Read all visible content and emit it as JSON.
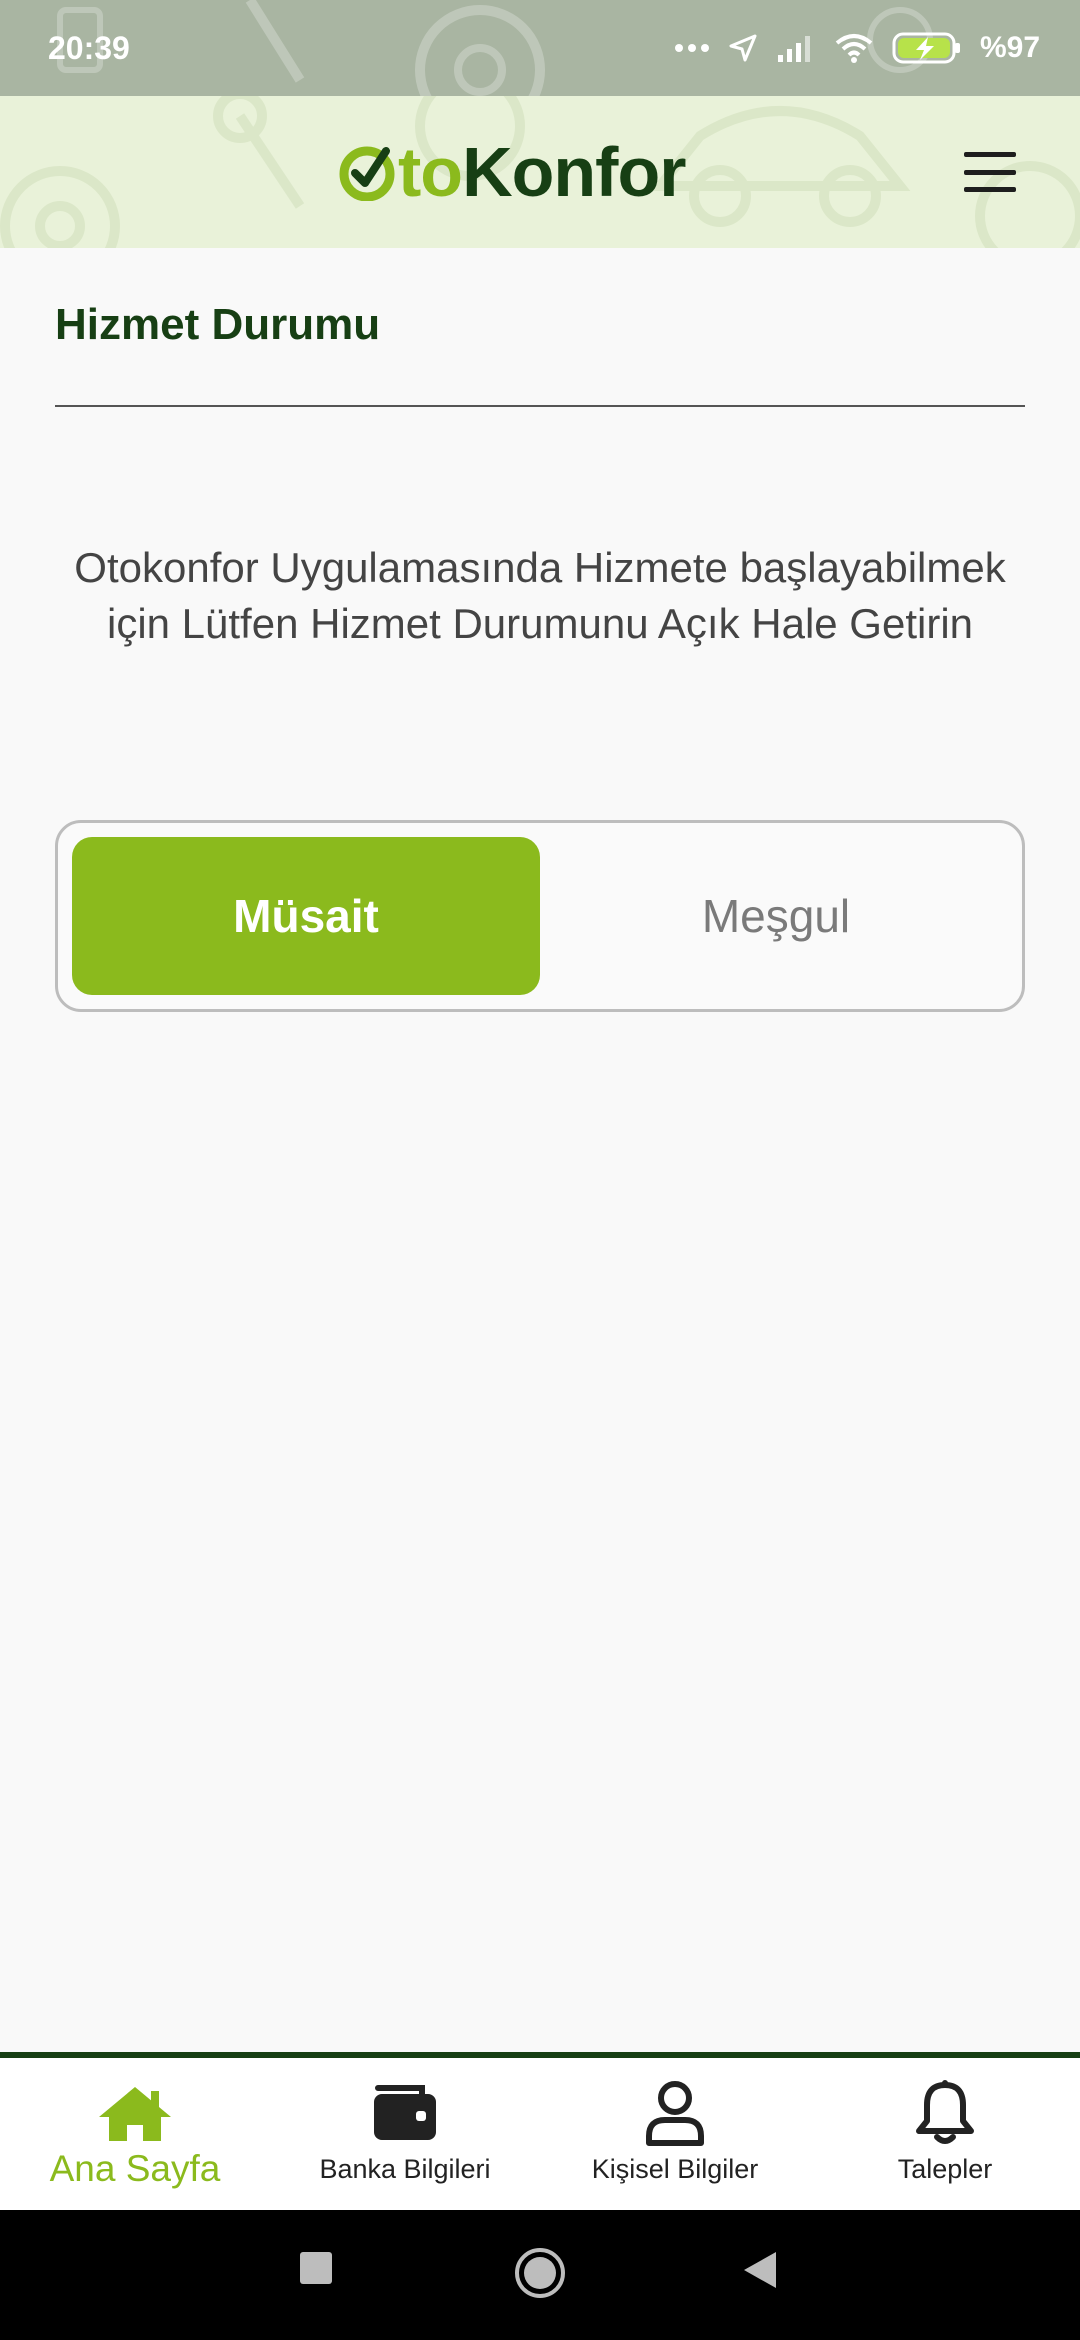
{
  "status_bar": {
    "time": "20:39",
    "battery": "%97",
    "icons": [
      "more-dots-icon",
      "location-arrow-icon",
      "signal-icon",
      "wifi-icon",
      "battery-charging-icon"
    ]
  },
  "header": {
    "logo_part1": "to",
    "logo_part2": "Konfor",
    "menu_icon": "hamburger-menu-icon"
  },
  "main": {
    "section_title": "Hizmet Durumu",
    "info_text": "Otokonfor Uygulamasında Hizmete başlayabilmek için Lütfen Hizmet Durumunu Açık Hale Getirin",
    "toggle": {
      "options": [
        "Müsait",
        "Meşgul"
      ],
      "selected": "Müsait"
    }
  },
  "bottom_nav": {
    "items": [
      {
        "label": "Ana Sayfa",
        "icon": "home-icon",
        "active": true
      },
      {
        "label": "Banka Bilgileri",
        "icon": "wallet-icon",
        "active": false
      },
      {
        "label": "Kişisel Bilgiler",
        "icon": "person-icon",
        "active": false
      },
      {
        "label": "Talepler",
        "icon": "bell-icon",
        "active": false
      }
    ]
  },
  "colors": {
    "accent": "#8bba1d",
    "brand_dark": "#173f14",
    "header_bg": "#e9f2d9"
  }
}
